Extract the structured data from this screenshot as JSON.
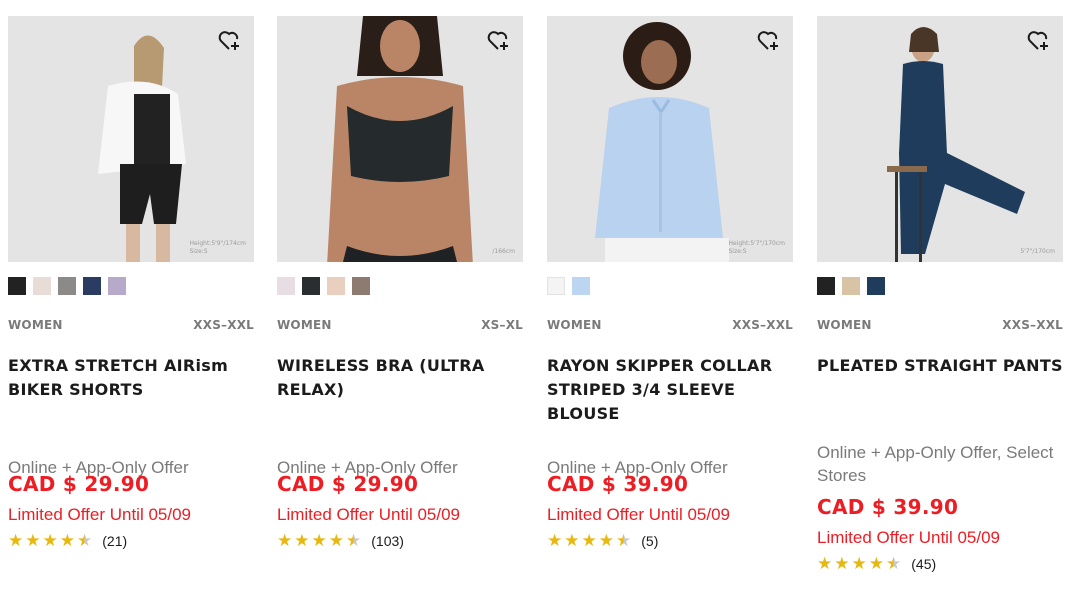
{
  "products": [
    {
      "gender": "WOMEN",
      "sizes": "XXS–XXL",
      "name": "EXTRA STRETCH AIRism BIKER SHORTS",
      "offer": "Online + App-Only Offer",
      "price": "CAD $ 29.90",
      "limited": "Limited Offer Until 05/09",
      "rating": 4.5,
      "review_count": "(21)",
      "model_hint": "Height:5'9\"/174cm\nSize:S",
      "swatches": [
        "#222222",
        "#e8ddd6",
        "#8c8a88",
        "#2b3c63",
        "#b7a9c9"
      ]
    },
    {
      "gender": "WOMEN",
      "sizes": "XS–XL",
      "name": "WIRELESS BRA (ULTRA RELAX)",
      "offer": "Online + App-Only Offer",
      "price": "CAD $ 29.90",
      "limited": "Limited Offer Until 05/09",
      "rating": 4.5,
      "review_count": "(103)",
      "model_hint": "/166cm",
      "swatches": [
        "#e7dde2",
        "#2a2e31",
        "#e9cfbf",
        "#8d7b71"
      ]
    },
    {
      "gender": "WOMEN",
      "sizes": "XXS–XXL",
      "name": "RAYON SKIPPER COLLAR STRIPED 3/4 SLEEVE BLOUSE",
      "offer": "Online + App-Only Offer",
      "price": "CAD $ 39.90",
      "limited": "Limited Offer Until 05/09",
      "rating": 4.5,
      "review_count": "(5)",
      "model_hint": "Height:5'7\"/170cm\nSize:S",
      "swatches": [
        "#f4f4f4",
        "#bcd5f0"
      ]
    },
    {
      "gender": "WOMEN",
      "sizes": "XXS–XXL",
      "name": "PLEATED STRAIGHT PANTS",
      "offer": "Online + App-Only Offer, Select Stores",
      "price": "CAD $ 39.90",
      "limited": "Limited Offer Until 05/09",
      "rating": 4.5,
      "review_count": "(45)",
      "model_hint": "5'7\"/170cm",
      "swatches": [
        "#222222",
        "#d8c4a4",
        "#1f3c5c"
      ]
    }
  ],
  "colors": {
    "price_red": "#ed1d24",
    "star_gold": "#e8b812"
  },
  "icons": {
    "favorite": "heart-plus-icon",
    "star": "star-icon"
  }
}
